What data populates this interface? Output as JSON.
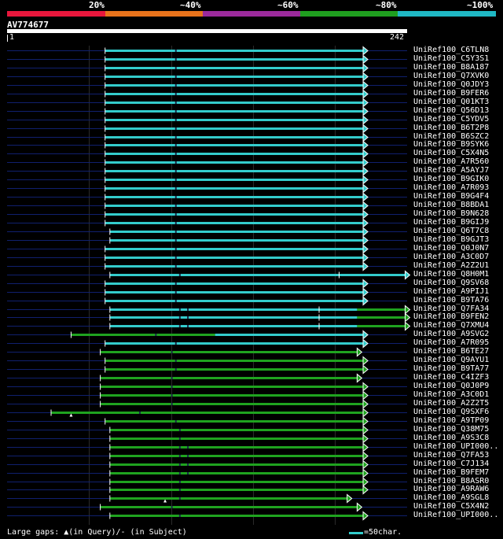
{
  "scale": {
    "labels": [
      "20%",
      "~40%",
      "~60%",
      "~80%",
      "~100%"
    ],
    "colors": [
      "#e8173c",
      "#e8731b",
      "#9b2a9b",
      "#1f9e1f",
      "#1fb8c4"
    ]
  },
  "query": {
    "id": "AV774677",
    "start": "1",
    "end": "242"
  },
  "hits": [
    {
      "label": "UniRef100_C6TLN8",
      "color": "cyan",
      "q_start": 0.245,
      "q_end": 0.89,
      "gaps": [
        0.42
      ],
      "subject_gaps": []
    },
    {
      "label": "UniRef100_C5Y3S1",
      "color": "cyan",
      "q_start": 0.245,
      "q_end": 0.89,
      "gaps": [
        0.42
      ],
      "subject_gaps": []
    },
    {
      "label": "UniRef100_B8A187",
      "color": "cyan",
      "q_start": 0.245,
      "q_end": 0.89,
      "gaps": [
        0.42
      ],
      "subject_gaps": []
    },
    {
      "label": "UniRef100_Q7XVK0",
      "color": "cyan",
      "q_start": 0.245,
      "q_end": 0.89,
      "gaps": [
        0.42
      ],
      "subject_gaps": []
    },
    {
      "label": "UniRef100_Q0JDY3",
      "color": "cyan",
      "q_start": 0.245,
      "q_end": 0.89,
      "gaps": [
        0.42
      ],
      "subject_gaps": []
    },
    {
      "label": "UniRef100_B9FER6",
      "color": "cyan",
      "q_start": 0.245,
      "q_end": 0.89,
      "gaps": [
        0.42
      ],
      "subject_gaps": []
    },
    {
      "label": "UniRef100_Q01KT3",
      "color": "cyan",
      "q_start": 0.245,
      "q_end": 0.89,
      "gaps": [
        0.42
      ],
      "subject_gaps": []
    },
    {
      "label": "UniRef100_Q56D13",
      "color": "cyan",
      "q_start": 0.245,
      "q_end": 0.89,
      "gaps": [
        0.42
      ],
      "subject_gaps": []
    },
    {
      "label": "UniRef100_C5YDV5",
      "color": "cyan",
      "q_start": 0.245,
      "q_end": 0.89,
      "gaps": [
        0.42
      ],
      "subject_gaps": []
    },
    {
      "label": "UniRef100_B6T2P8",
      "color": "cyan",
      "q_start": 0.245,
      "q_end": 0.89,
      "gaps": [
        0.42
      ],
      "subject_gaps": []
    },
    {
      "label": "UniRef100_B6SZC2",
      "color": "cyan",
      "q_start": 0.245,
      "q_end": 0.89,
      "gaps": [
        0.42
      ],
      "subject_gaps": []
    },
    {
      "label": "UniRef100_B9SYK6",
      "color": "cyan",
      "q_start": 0.245,
      "q_end": 0.89,
      "gaps": [
        0.42
      ],
      "subject_gaps": []
    },
    {
      "label": "UniRef100_C5X4N5",
      "color": "cyan",
      "q_start": 0.245,
      "q_end": 0.89,
      "gaps": [
        0.42
      ],
      "subject_gaps": []
    },
    {
      "label": "UniRef100_A7R560",
      "color": "cyan",
      "q_start": 0.245,
      "q_end": 0.89,
      "gaps": [
        0.42
      ],
      "subject_gaps": []
    },
    {
      "label": "UniRef100_A5AYJ7",
      "color": "cyan",
      "q_start": 0.245,
      "q_end": 0.89,
      "gaps": [
        0.42
      ],
      "subject_gaps": []
    },
    {
      "label": "UniRef100_B9GIK0",
      "color": "cyan",
      "q_start": 0.245,
      "q_end": 0.89,
      "gaps": [
        0.42
      ],
      "subject_gaps": []
    },
    {
      "label": "UniRef100_A7R093",
      "color": "cyan",
      "q_start": 0.245,
      "q_end": 0.89,
      "gaps": [
        0.42
      ],
      "subject_gaps": []
    },
    {
      "label": "UniRef100_B9G4F4",
      "color": "cyan",
      "q_start": 0.245,
      "q_end": 0.89,
      "gaps": [
        0.42
      ],
      "subject_gaps": []
    },
    {
      "label": "UniRef100_B8BDA1",
      "color": "cyan",
      "q_start": 0.245,
      "q_end": 0.89,
      "gaps": [
        0.42
      ],
      "subject_gaps": []
    },
    {
      "label": "UniRef100_B9N628",
      "color": "cyan",
      "q_start": 0.245,
      "q_end": 0.89,
      "gaps": [
        0.42
      ],
      "subject_gaps": []
    },
    {
      "label": "UniRef100_B9GIJ9",
      "color": "cyan",
      "q_start": 0.245,
      "q_end": 0.89,
      "gaps": [
        0.42
      ],
      "subject_gaps": []
    },
    {
      "label": "UniRef100_Q6T7C8",
      "color": "cyan",
      "q_start": 0.257,
      "q_end": 0.89,
      "gaps": [
        0.42
      ],
      "subject_gaps": []
    },
    {
      "label": "UniRef100_B9GJT3",
      "color": "cyan",
      "q_start": 0.257,
      "q_end": 0.89,
      "gaps": [
        0.42
      ],
      "subject_gaps": []
    },
    {
      "label": "UniRef100_Q0J0N7",
      "color": "cyan",
      "q_start": 0.245,
      "q_end": 0.89,
      "gaps": [
        0.42
      ],
      "subject_gaps": []
    },
    {
      "label": "UniRef100_A3C0D7",
      "color": "cyan",
      "q_start": 0.245,
      "q_end": 0.89,
      "gaps": [
        0.42
      ],
      "subject_gaps": []
    },
    {
      "label": "UniRef100_A2Z2U1",
      "color": "cyan",
      "q_start": 0.245,
      "q_end": 0.89,
      "gaps": [
        0.42
      ],
      "subject_gaps": []
    },
    {
      "label": "UniRef100_Q8H0M1",
      "color": "cyan",
      "q_start": 0.257,
      "q_end": 0.995,
      "gaps": [
        0.43
      ],
      "subject_gaps": [
        0.83
      ]
    },
    {
      "label": "UniRef100_Q9SV68",
      "color": "cyan",
      "q_start": 0.245,
      "q_end": 0.89,
      "gaps": [
        0.42
      ],
      "subject_gaps": []
    },
    {
      "label": "UniRef100_A9PIJ1",
      "color": "cyan",
      "q_start": 0.245,
      "q_end": 0.89,
      "gaps": [
        0.42
      ],
      "subject_gaps": []
    },
    {
      "label": "UniRef100_B9TA76",
      "color": "cyan",
      "q_start": 0.245,
      "q_end": 0.89,
      "gaps": [
        0.42
      ],
      "subject_gaps": []
    },
    {
      "label": "UniRef100_Q7FA34",
      "color": "cyan-green",
      "q_start": 0.257,
      "q_end": 0.995,
      "gaps": [
        0.43,
        0.45
      ],
      "subject_gaps": [
        0.78
      ]
    },
    {
      "label": "UniRef100_B9FEN2",
      "color": "cyan-green",
      "q_start": 0.257,
      "q_end": 0.995,
      "gaps": [
        0.43,
        0.45
      ],
      "subject_gaps": [
        0.78
      ]
    },
    {
      "label": "UniRef100_Q7XMU4",
      "color": "cyan-green",
      "q_start": 0.257,
      "q_end": 0.995,
      "gaps": [
        0.43,
        0.45
      ],
      "subject_gaps": [
        0.78
      ]
    },
    {
      "label": "UniRef100_A9SVG2",
      "color": "green-cyan",
      "q_start": 0.16,
      "q_end": 0.89,
      "gaps": [
        0.37
      ],
      "subject_gaps": []
    },
    {
      "label": "UniRef100_A7R095",
      "color": "cyan",
      "q_start": 0.245,
      "q_end": 0.89,
      "gaps": [
        0.42
      ],
      "subject_gaps": []
    },
    {
      "label": "UniRef100_B6TE27",
      "color": "green",
      "q_start": 0.233,
      "q_end": 0.875,
      "gaps": [
        0.41
      ],
      "subject_gaps": []
    },
    {
      "label": "UniRef100_Q9AYU1",
      "color": "green",
      "q_start": 0.245,
      "q_end": 0.89,
      "gaps": [
        0.42
      ],
      "subject_gaps": []
    },
    {
      "label": "UniRef100_B9TA77",
      "color": "green",
      "q_start": 0.245,
      "q_end": 0.89,
      "gaps": [
        0.42
      ],
      "subject_gaps": []
    },
    {
      "label": "UniRef100_C4IZF3",
      "color": "green",
      "q_start": 0.233,
      "q_end": 0.875,
      "gaps": [
        0.41
      ],
      "subject_gaps": []
    },
    {
      "label": "UniRef100_Q0J0P9",
      "color": "green",
      "q_start": 0.233,
      "q_end": 0.89,
      "gaps": [
        0.41
      ],
      "subject_gaps": []
    },
    {
      "label": "UniRef100_A3C0D1",
      "color": "green",
      "q_start": 0.233,
      "q_end": 0.89,
      "gaps": [
        0.41
      ],
      "subject_gaps": []
    },
    {
      "label": "UniRef100_A2Z2T5",
      "color": "green",
      "q_start": 0.233,
      "q_end": 0.89,
      "gaps": [
        0.41
      ],
      "subject_gaps": []
    },
    {
      "label": "UniRef100_Q9SXF6",
      "color": "green",
      "q_start": 0.11,
      "q_end": 0.89,
      "gaps": [
        0.33
      ],
      "subject_gaps": [],
      "query_gap_mark": 0.16
    },
    {
      "label": "UniRef100_A9TP09",
      "color": "green",
      "q_start": 0.245,
      "q_end": 0.89,
      "gaps": [
        0.42
      ],
      "subject_gaps": []
    },
    {
      "label": "UniRef100_Q38M75",
      "color": "green",
      "q_start": 0.257,
      "q_end": 0.89,
      "gaps": [
        0.43
      ],
      "subject_gaps": []
    },
    {
      "label": "UniRef100_A9S3C8",
      "color": "green",
      "q_start": 0.257,
      "q_end": 0.89,
      "gaps": [
        0.43
      ],
      "subject_gaps": []
    },
    {
      "label": "UniRef100_UPI000..",
      "color": "green",
      "q_start": 0.257,
      "q_end": 0.89,
      "gaps": [
        0.43,
        0.45
      ],
      "subject_gaps": []
    },
    {
      "label": "UniRef100_Q7FA53",
      "color": "green",
      "q_start": 0.257,
      "q_end": 0.89,
      "gaps": [
        0.43,
        0.45
      ],
      "subject_gaps": []
    },
    {
      "label": "UniRef100_C7J134",
      "color": "green",
      "q_start": 0.257,
      "q_end": 0.89,
      "gaps": [
        0.43,
        0.45
      ],
      "subject_gaps": []
    },
    {
      "label": "UniRef100_B9FEM7",
      "color": "green",
      "q_start": 0.257,
      "q_end": 0.89,
      "gaps": [
        0.43,
        0.45
      ],
      "subject_gaps": []
    },
    {
      "label": "UniRef100_B8ASR0",
      "color": "green",
      "q_start": 0.257,
      "q_end": 0.89,
      "gaps": [
        0.43
      ],
      "subject_gaps": []
    },
    {
      "label": "UniRef100_A9RAW6",
      "color": "green",
      "q_start": 0.257,
      "q_end": 0.89,
      "gaps": [
        0.43
      ],
      "subject_gaps": []
    },
    {
      "label": "UniRef100_A9SGL8",
      "color": "green",
      "q_start": 0.257,
      "q_end": 0.85,
      "gaps": [
        0.43
      ],
      "subject_gaps": [],
      "query_gap_mark": 0.395
    },
    {
      "label": "UniRef100_C5X4N2",
      "color": "green",
      "q_start": 0.233,
      "q_end": 0.875,
      "gaps": [
        0.41
      ],
      "subject_gaps": []
    },
    {
      "label": "UniRef100_UPI000..",
      "color": "green",
      "q_start": 0.257,
      "q_end": 0.89,
      "gaps": [
        0.43
      ],
      "subject_gaps": []
    }
  ],
  "footer": {
    "text": "Large gaps: ▲(in Query)/- (in Subject)",
    "legend_text": "=50char."
  }
}
